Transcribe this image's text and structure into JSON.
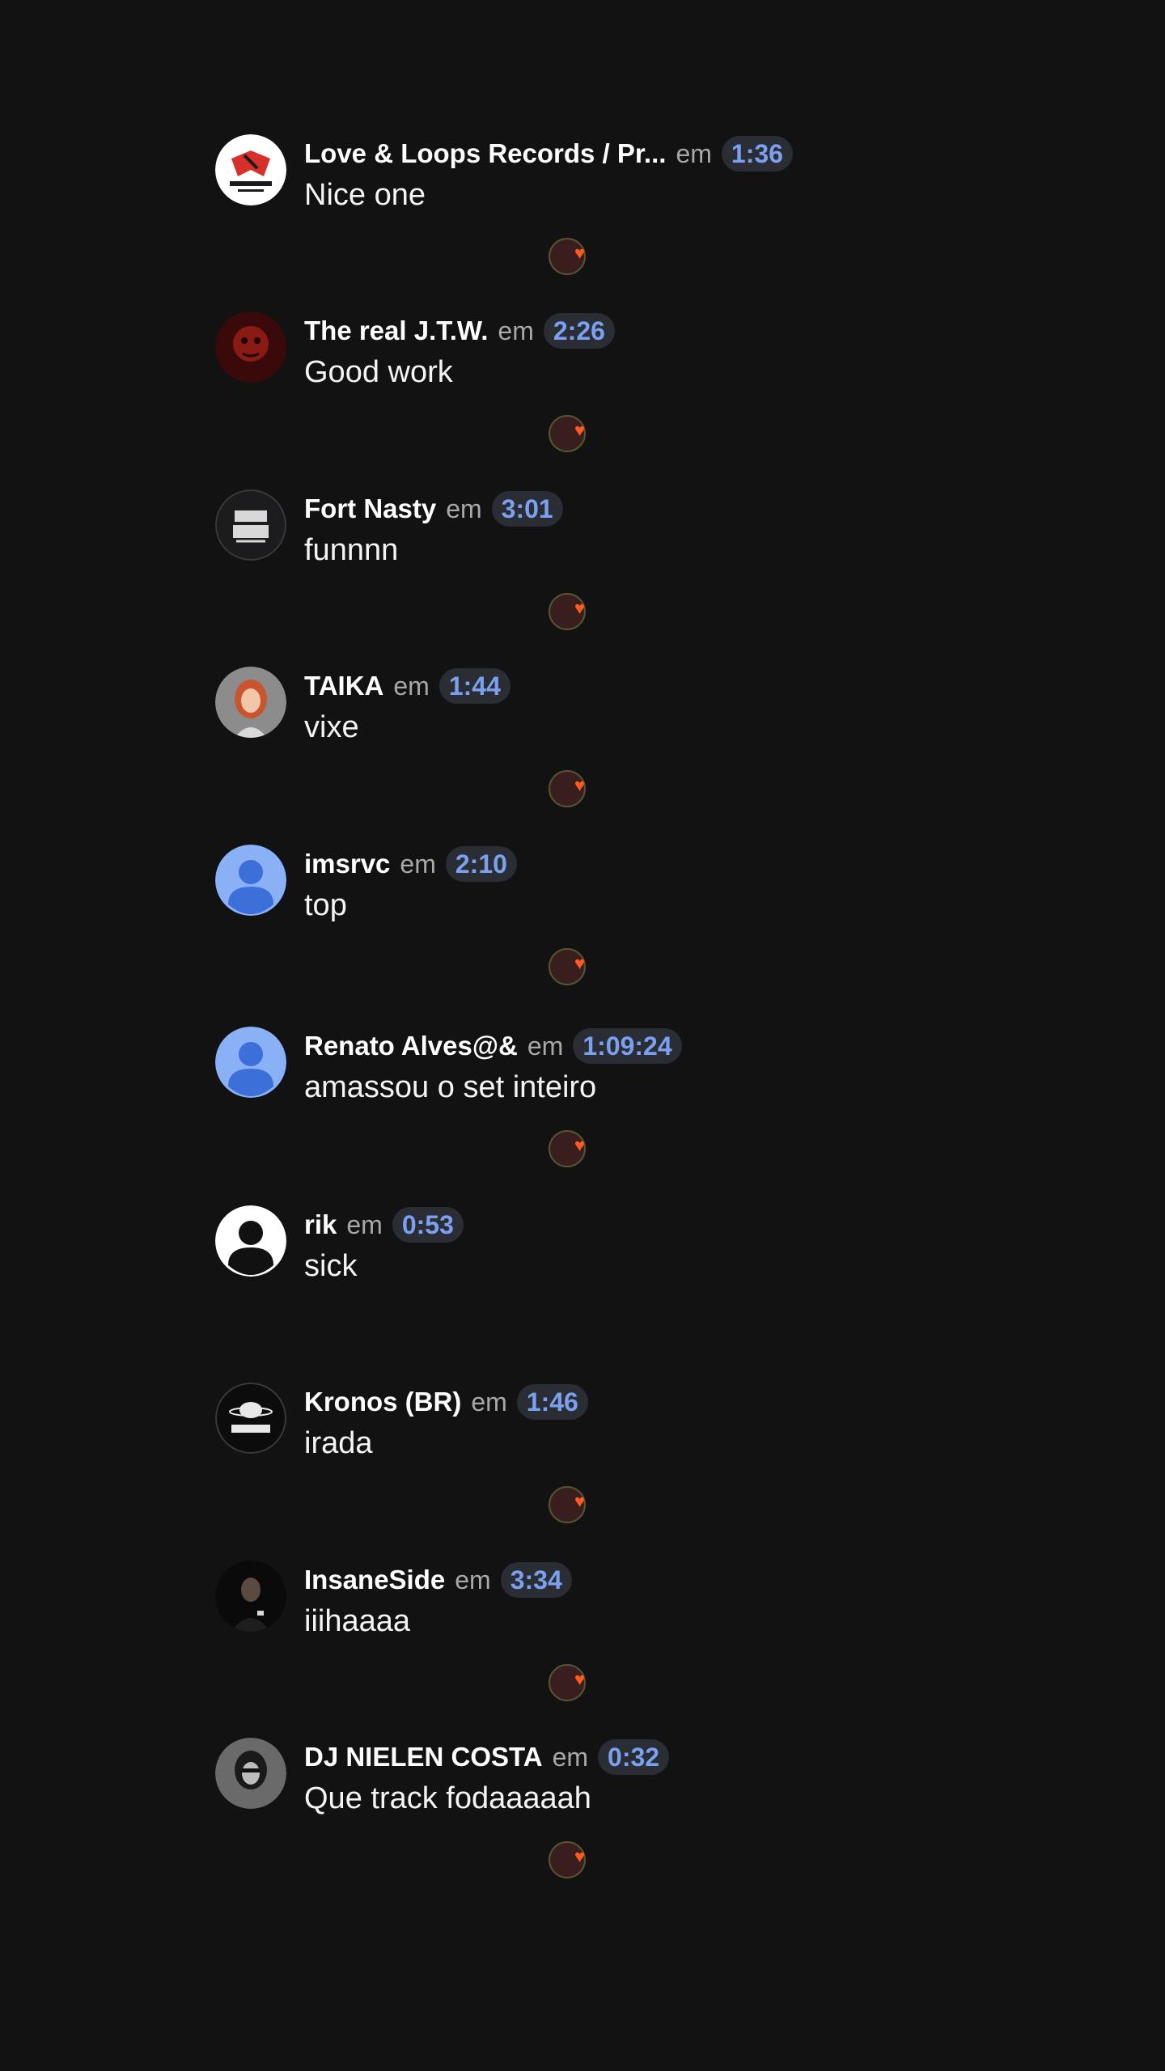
{
  "comments": [
    {
      "user": "Love & Loops Records / Pr...",
      "em": "em",
      "time": "1:36",
      "text": "Nice one",
      "avatar": "love-loops-logo",
      "reaction": true
    },
    {
      "user": "The real J.T.W.",
      "em": "em",
      "time": "2:26",
      "text": "Good work",
      "avatar": "red-portrait",
      "reaction": true
    },
    {
      "user": "Fort Nasty",
      "em": "em",
      "time": "3:01",
      "text": "funnnn",
      "avatar": "fort-nasty-logo",
      "reaction": true
    },
    {
      "user": "TAIKA",
      "em": "em",
      "time": "1:44",
      "text": "vixe",
      "avatar": "woman-portrait",
      "reaction": true
    },
    {
      "user": "imsrvc",
      "em": "em",
      "time": "2:10",
      "text": "top",
      "avatar": "default-user-blue",
      "reaction": true
    },
    {
      "user": "Renato Alves@&",
      "em": "em",
      "time": "1:09:24",
      "text": "amassou o set inteiro",
      "avatar": "default-user-blue",
      "reaction": true
    },
    {
      "user": "rik",
      "em": "em",
      "time": "0:53",
      "text": "sick",
      "avatar": "default-user-white",
      "reaction": false
    },
    {
      "user": "Kronos (BR)",
      "em": "em",
      "time": "1:46",
      "text": "irada",
      "avatar": "kronos-logo",
      "reaction": true
    },
    {
      "user": "InsaneSide",
      "em": "em",
      "time": "3:34",
      "text": "iiihaaaa",
      "avatar": "man-portrait",
      "reaction": true
    },
    {
      "user": "DJ NIELEN COSTA",
      "em": "em",
      "time": "0:32",
      "text": "Que track fodaaaaah",
      "avatar": "bw-portrait",
      "reaction": true
    }
  ],
  "colors": {
    "background": "#121212",
    "timestamp_text": "#7aa0ef",
    "timestamp_bg": "#2a2d33",
    "heart": "#ff5a1f"
  },
  "icons": {
    "reaction": "heart-icon"
  }
}
